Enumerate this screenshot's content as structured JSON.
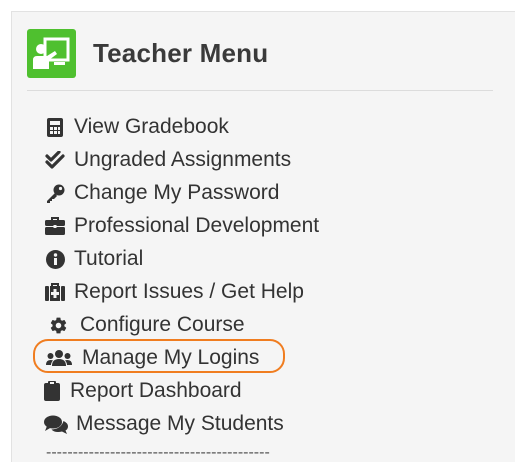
{
  "header": {
    "title": "Teacher Menu",
    "icon": "teacher-board-icon",
    "accent": "#4fc02f"
  },
  "menu": {
    "items": [
      {
        "label": "View Gradebook",
        "icon": "calculator-icon"
      },
      {
        "label": "Ungraded Assignments",
        "icon": "double-check-icon"
      },
      {
        "label": "Change My Password",
        "icon": "key-icon"
      },
      {
        "label": "Professional Development",
        "icon": "briefcase-icon"
      },
      {
        "label": "Tutorial",
        "icon": "info-circle-icon"
      },
      {
        "label": "Report Issues / Get Help",
        "icon": "medkit-icon"
      },
      {
        "label": "Configure Course",
        "icon": "gear-icon"
      },
      {
        "label": "Manage My Logins",
        "icon": "users-icon",
        "highlighted": true
      },
      {
        "label": "Report Dashboard",
        "icon": "clipboard-icon"
      },
      {
        "label": "Message My Students",
        "icon": "comments-icon"
      }
    ],
    "separator": "------------------------------------------",
    "highlight_color": "#f07d20"
  }
}
